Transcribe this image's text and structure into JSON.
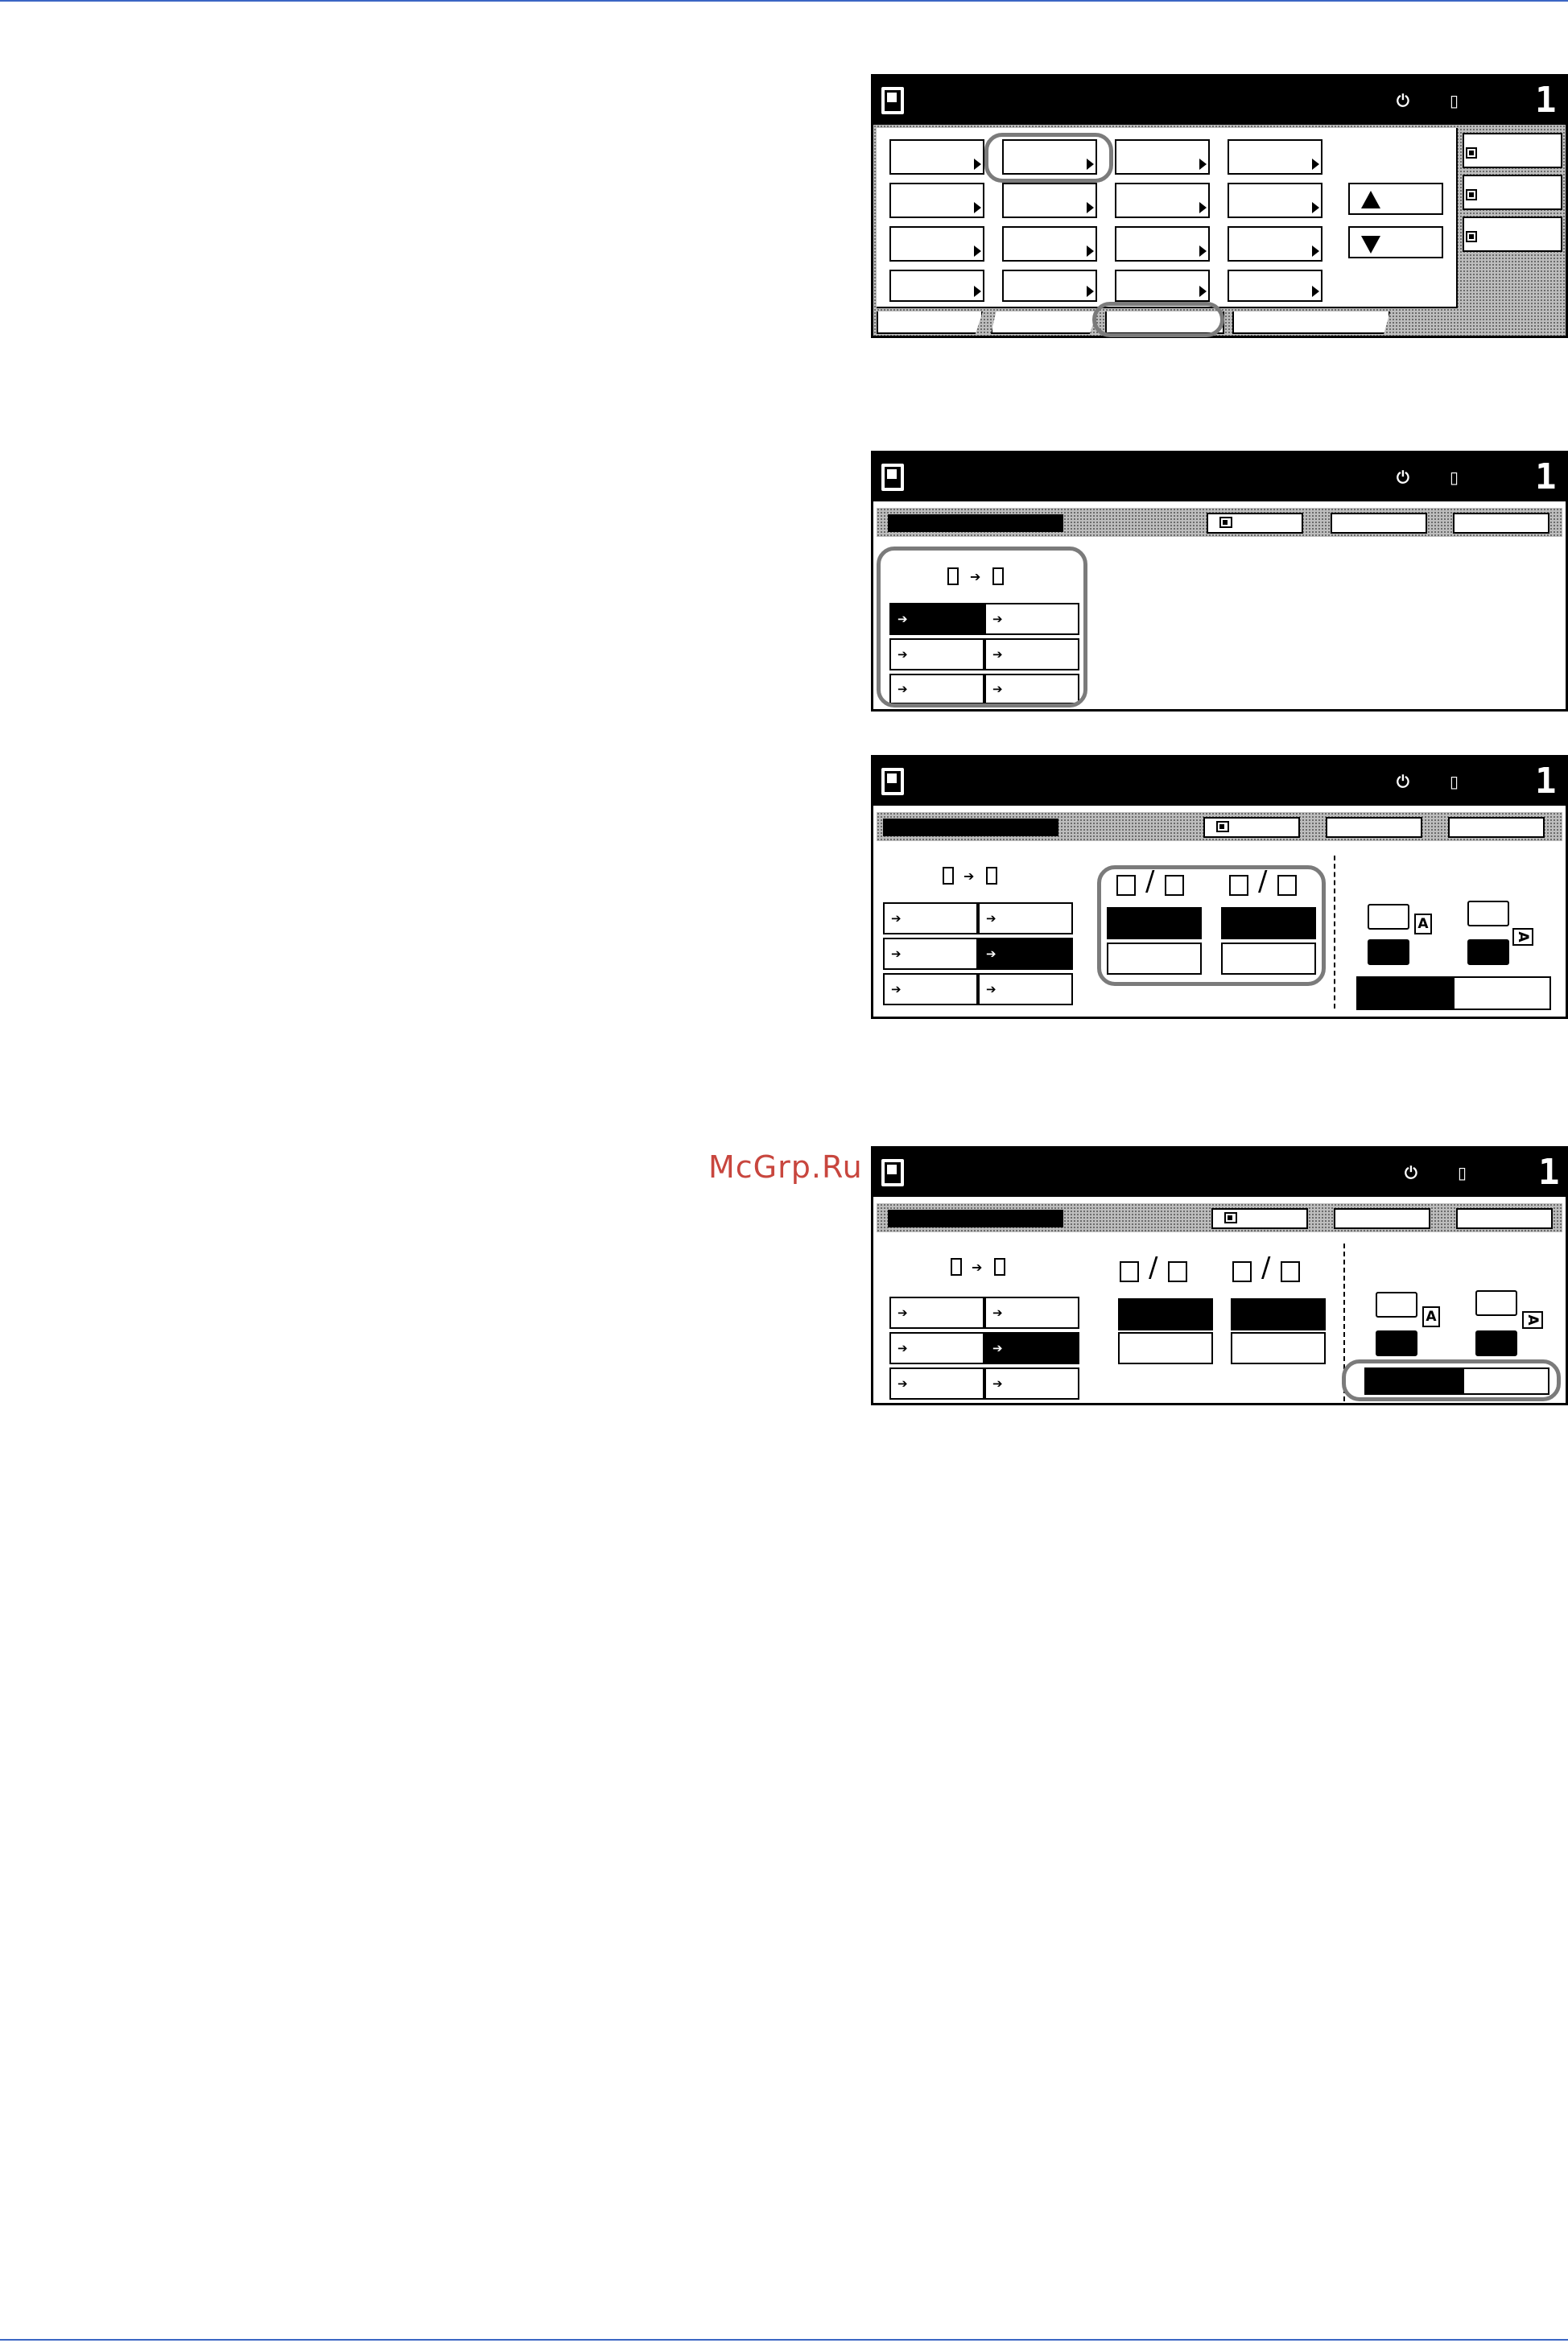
{
  "watermark": "McGrp.Ru",
  "panel_status": {
    "count": "1"
  },
  "colors": {
    "rule": "#3b66c4",
    "highlight": "#7b7b7b",
    "watermark": "#c8463e"
  }
}
